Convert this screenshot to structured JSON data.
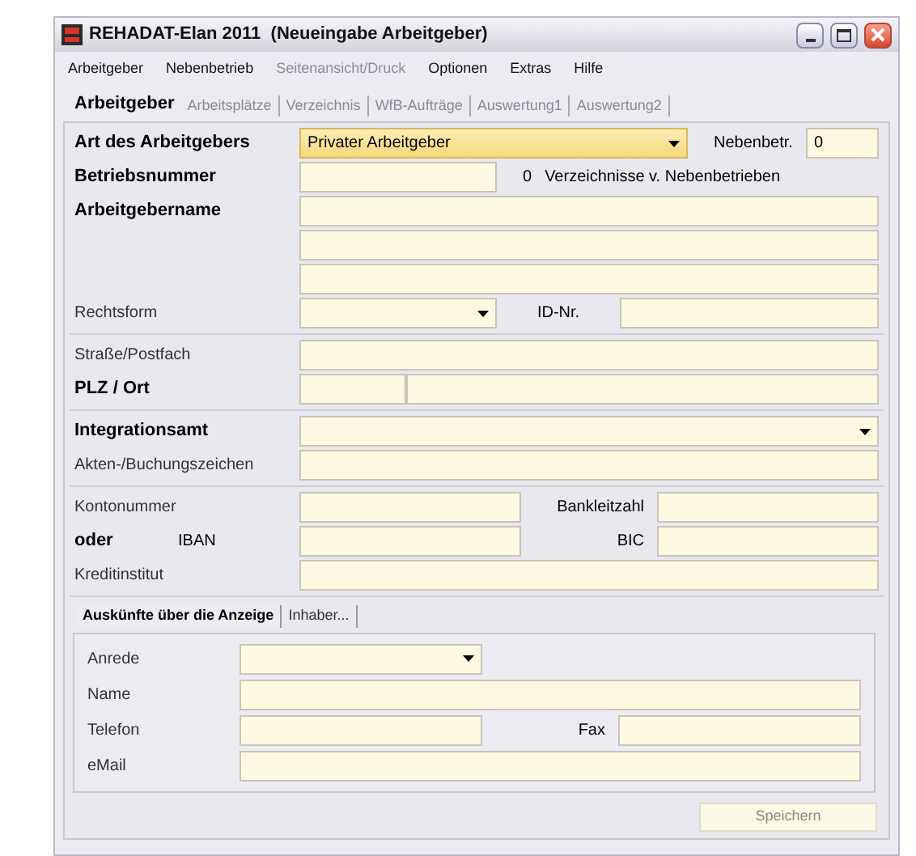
{
  "window": {
    "title": "REHADAT-Elan 2011  (Neueingabe Arbeitgeber)"
  },
  "menu": [
    {
      "label": "Arbeitgeber",
      "disabled": false
    },
    {
      "label": "Nebenbetrieb",
      "disabled": false
    },
    {
      "label": "Seitenansicht/Druck",
      "disabled": true
    },
    {
      "label": "Optionen",
      "disabled": false
    },
    {
      "label": "Extras",
      "disabled": false
    },
    {
      "label": "Hilfe",
      "disabled": false
    }
  ],
  "tabs": [
    {
      "label": "Arbeitgeber",
      "selected": true
    },
    {
      "label": "Arbeitsplätze",
      "selected": false
    },
    {
      "label": "Verzeichnis",
      "selected": false
    },
    {
      "label": "WfB-Aufträge",
      "selected": false
    },
    {
      "label": "Auswertung1",
      "selected": false
    },
    {
      "label": "Auswertung2",
      "selected": false
    }
  ],
  "sections": [
    {
      "rows": [
        {
          "kind": "select_side",
          "label": "Art des Arbeitgebers",
          "bold": true,
          "value": "Privater Arbeitgeber",
          "focused": true,
          "side_label": "Nebenbetr.",
          "side_value": "0"
        },
        {
          "kind": "field_note",
          "label": "Betriebsnummer",
          "bold": true,
          "count": "0",
          "note": "Verzeichnisse v. Nebenbetrieben"
        },
        {
          "kind": "field",
          "label": "Arbeitgebername",
          "bold": true
        },
        {
          "kind": "field"
        },
        {
          "kind": "field"
        },
        {
          "kind": "select_id",
          "label": "Rechtsform",
          "bold": false,
          "side_label": "ID-Nr."
        }
      ]
    },
    {
      "rows": [
        {
          "kind": "field",
          "label": "Straße/Postfach",
          "bold": false
        },
        {
          "kind": "split",
          "label": "PLZ / Ort",
          "bold": true
        }
      ]
    },
    {
      "rows": [
        {
          "kind": "select",
          "label": "Integrationsamt",
          "bold": true
        },
        {
          "kind": "field",
          "label": "Akten-/Buchungszeichen",
          "bold": false
        }
      ]
    },
    {
      "rows": [
        {
          "kind": "pair",
          "label": "Kontonummer",
          "bold": false,
          "side_label": "Bankleitzahl"
        },
        {
          "kind": "pair",
          "label": "oder",
          "bold": true,
          "sublabel": "IBAN",
          "side_label": "BIC"
        },
        {
          "kind": "field",
          "label": "Kreditinstitut",
          "bold": false
        }
      ]
    }
  ],
  "sub_tabs": [
    {
      "label": "Auskünfte über die Anzeige",
      "selected": true
    },
    {
      "label": "Inhaber...",
      "selected": false
    }
  ],
  "sub_rows": [
    {
      "kind": "select",
      "label": "Anrede",
      "bold": false
    },
    {
      "kind": "field",
      "label": "Name",
      "bold": false
    },
    {
      "kind": "pair",
      "label": "Telefon",
      "bold": false,
      "side_label": "Fax"
    },
    {
      "kind": "field",
      "label": "eMail",
      "bold": false
    }
  ],
  "save_button": {
    "label": "Speichern",
    "disabled": true
  }
}
